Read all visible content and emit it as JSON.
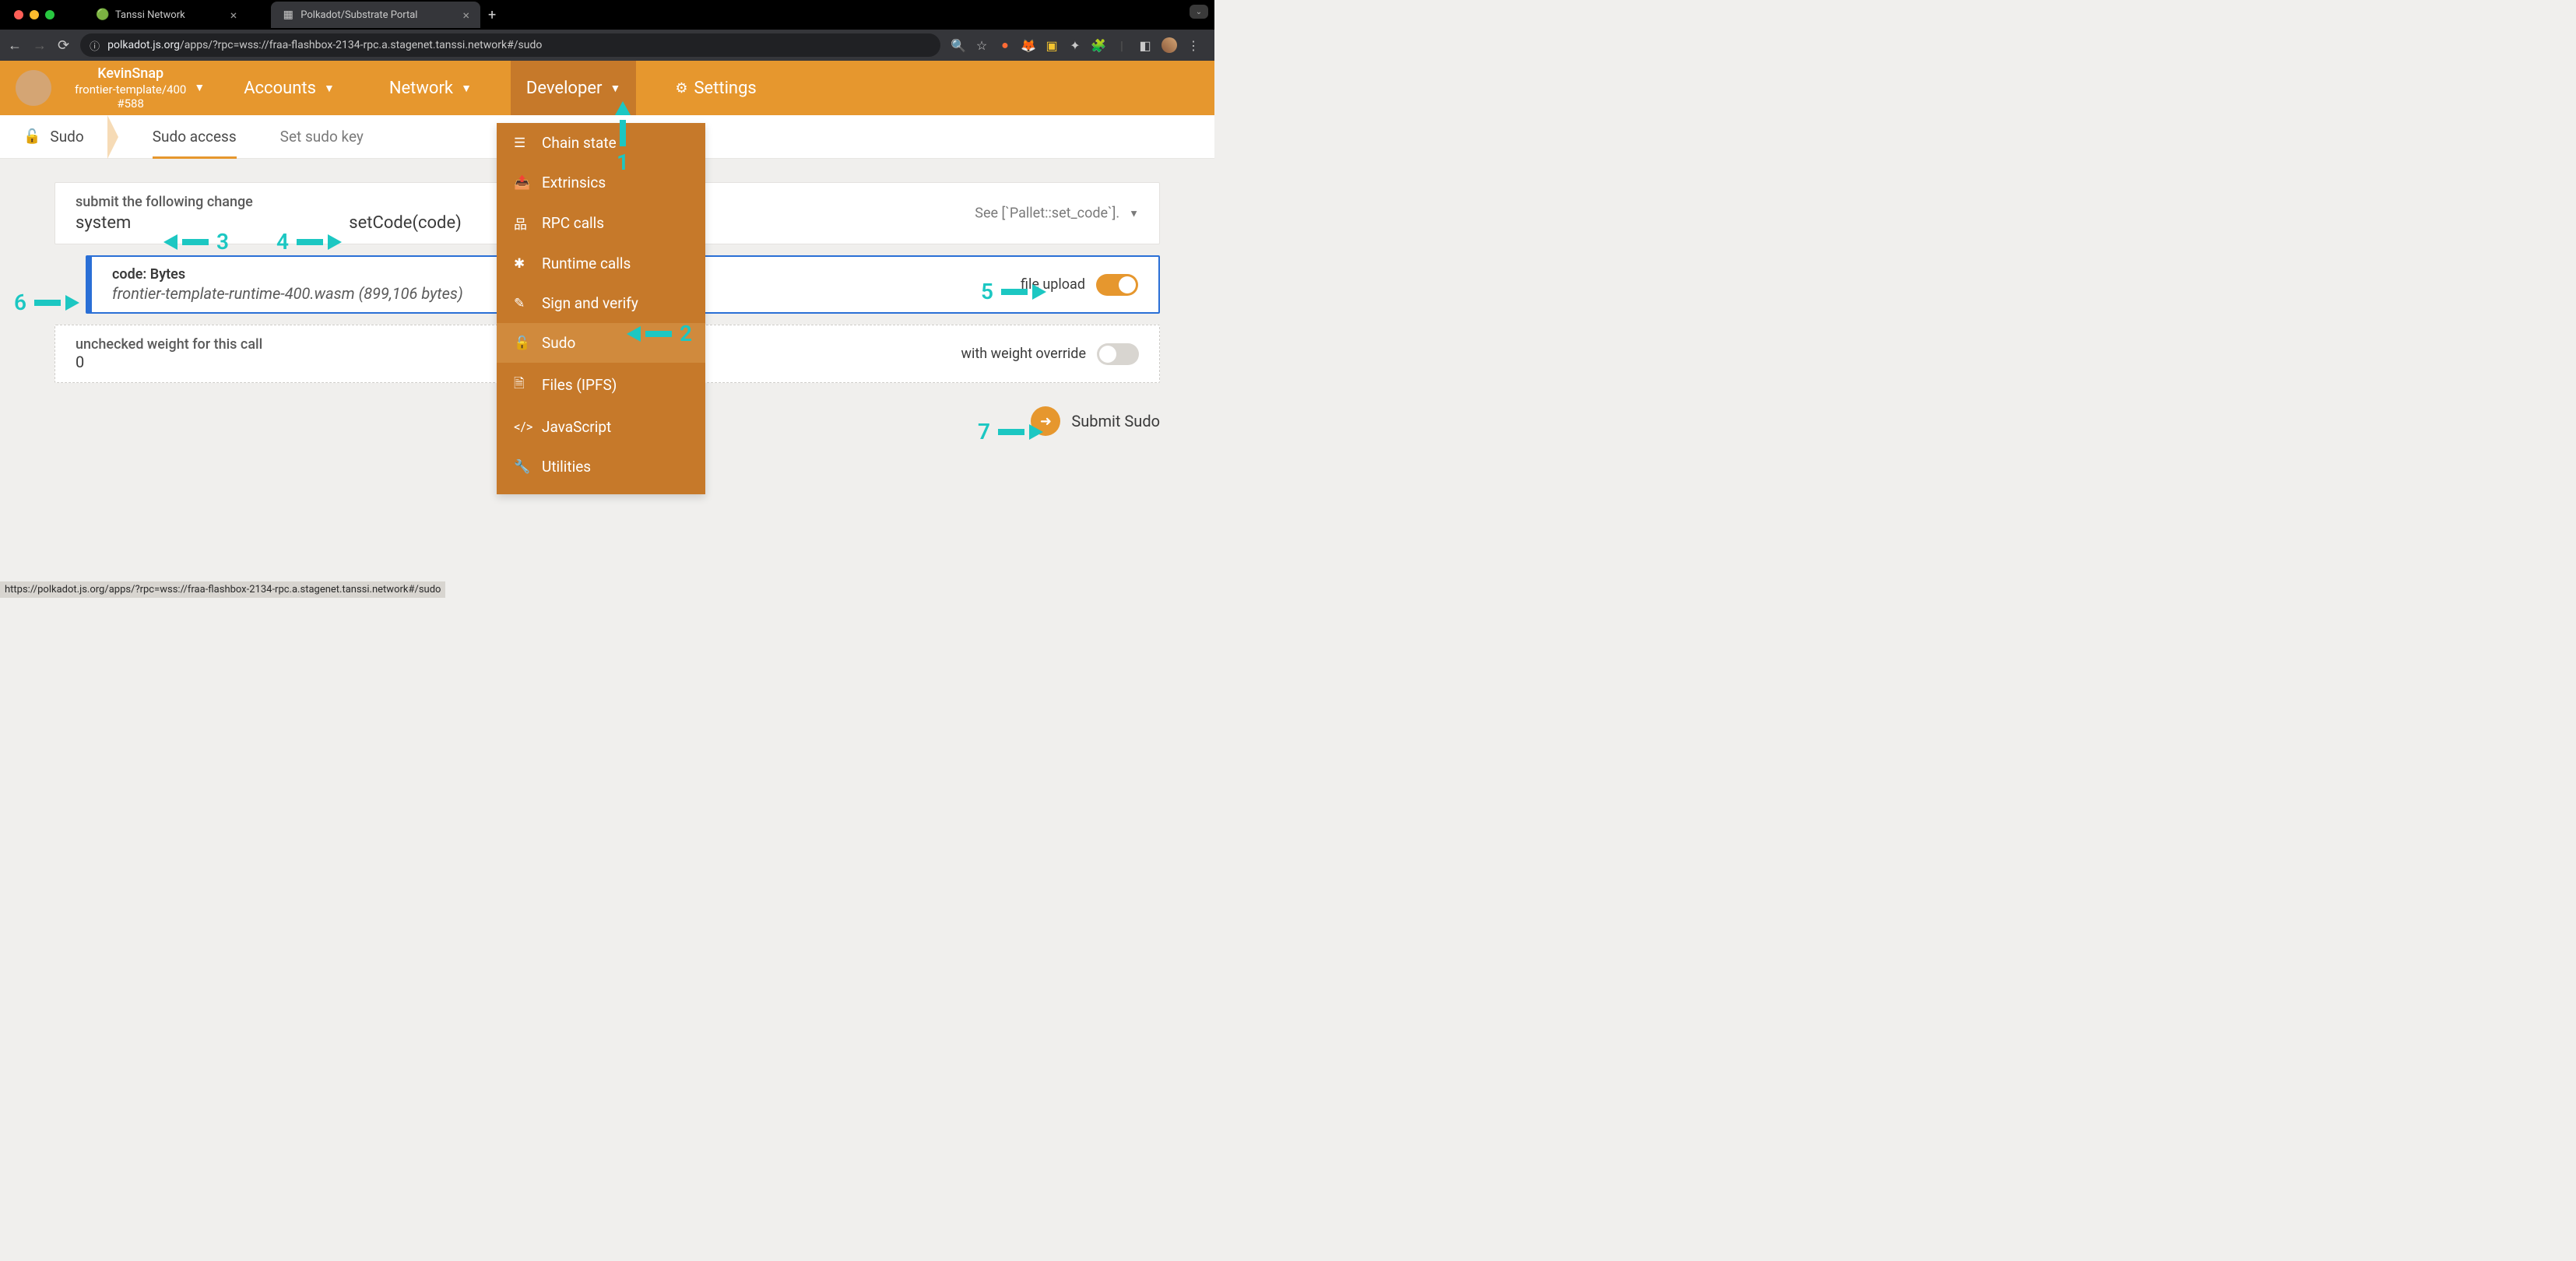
{
  "browser": {
    "tabs": [
      {
        "title": "Tanssi Network",
        "active": false
      },
      {
        "title": "Polkadot/Substrate Portal",
        "active": true
      }
    ],
    "url_domain": "polkadot.js.org",
    "url_path": "/apps/?rpc=wss://fraa-flashbox-2134-rpc.a.stagenet.tanssi.network#/sudo"
  },
  "header": {
    "chain_name": "KevinSnap",
    "chain_sub": "frontier-template/400",
    "block_number": "#588",
    "nav": {
      "accounts": "Accounts",
      "network": "Network",
      "developer": "Developer",
      "settings": "Settings"
    }
  },
  "subnav": {
    "root": "Sudo",
    "tabs": {
      "sudo_access": "Sudo access",
      "set_key": "Set sudo key"
    }
  },
  "dropdown": {
    "chain_state": "Chain state",
    "extrinsics": "Extrinsics",
    "rpc_calls": "RPC calls",
    "runtime_calls": "Runtime calls",
    "sign_verify": "Sign and verify",
    "sudo": "Sudo",
    "files": "Files (IPFS)",
    "javascript": "JavaScript",
    "utilities": "Utilities"
  },
  "form": {
    "submit_label": "submit the following change",
    "pallet": "system",
    "method": "setCode(code)",
    "docs": "See [`Pallet::set_code`].",
    "code_label": "code: Bytes",
    "code_file": "frontier-template-runtime-400.wasm (899,106 bytes)",
    "file_upload_label": "file upload",
    "weight_label": "unchecked weight for this call",
    "weight_value": "0",
    "weight_override_label": "with weight override",
    "submit_button": "Submit Sudo"
  },
  "annotations": {
    "a1": "1",
    "a2": "2",
    "a3": "3",
    "a4": "4",
    "a5": "5",
    "a6": "6",
    "a7": "7"
  },
  "status_bar": "https://polkadot.js.org/apps/?rpc=wss://fraa-flashbox-2134-rpc.a.stagenet.tanssi.network#/sudo"
}
